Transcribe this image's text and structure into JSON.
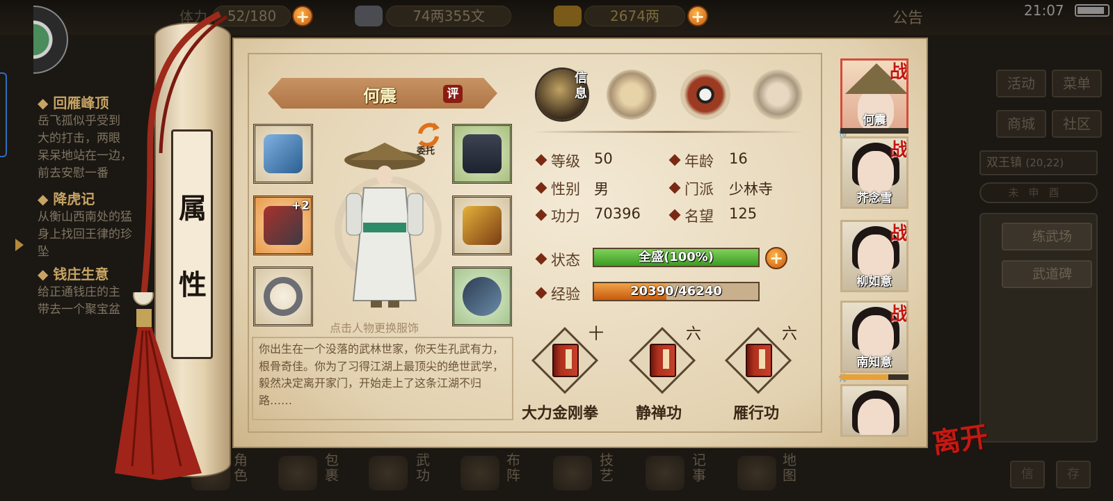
{
  "status_bar": {
    "time": "21:07"
  },
  "resources": {
    "stamina": "52/180",
    "stamina_label": "体力",
    "silver": "74两355文",
    "gold": "2674两",
    "notice": "公告"
  },
  "quests": [
    {
      "title": "回雁峰顶",
      "lines": [
        "岳飞孤似乎受到",
        "大的打击，两眼",
        "呆呆地站在一边，",
        "前去安慰一番"
      ]
    },
    {
      "title": "降虎记",
      "lines": [
        "从衡山西南处的猛",
        "身上找回王律的珍",
        "坠"
      ]
    },
    {
      "title": "钱庄生意",
      "lines": [
        "给正通钱庄的主",
        "带去一个聚宝盆"
      ]
    }
  ],
  "right_menu": {
    "activities": "活动",
    "menu": "菜单",
    "shop": "商城",
    "community": "社区",
    "town": "双王镇",
    "coords": "(20,22)",
    "time_bar": [
      "未",
      "申",
      "酉"
    ],
    "facilities": [
      "练武场",
      "武道碑"
    ],
    "bottom": [
      "信",
      "存"
    ]
  },
  "scroll_title": [
    "属",
    "性"
  ],
  "character": {
    "name": "何震",
    "rate_badge": "评",
    "entrust": "委托",
    "hint": "点击人物更换服饰",
    "bio": "你出生在一个没落的武林世家，你天生孔武有力，根骨奇佳。你为了习得江湖上最顶尖的绝世武学，毅然决定离开家门，开始走上了这条江湖不归路……",
    "equipment": [
      {
        "icon": "gauntlet-icon",
        "plus": ""
      },
      {
        "icon": "cuirass-icon",
        "plus": "+2"
      },
      {
        "icon": "ring-icon",
        "plus": ""
      },
      {
        "icon": "belt-icon",
        "plus": ""
      },
      {
        "icon": "armor-icon",
        "plus": ""
      },
      {
        "icon": "fish-amulet-icon",
        "plus": ""
      }
    ]
  },
  "tabs": {
    "info": "信息"
  },
  "stats": {
    "level_label": "等级",
    "level": "50",
    "age_label": "年龄",
    "age": "16",
    "gender_label": "性别",
    "gender": "男",
    "sect_label": "门派",
    "sect": "少林寺",
    "power_label": "功力",
    "power": "70396",
    "fame_label": "名望",
    "fame": "125",
    "status_label": "状态",
    "status": "全盛(100%)",
    "status_pct": 100,
    "exp_label": "经验",
    "exp": "20390/46240",
    "exp_pct": 44
  },
  "skills": [
    {
      "level": "十",
      "name": "大力金刚拳"
    },
    {
      "level": "六",
      "name": "静禅功"
    },
    {
      "level": "六",
      "name": "雁行功"
    }
  ],
  "party": [
    {
      "name": "何震",
      "battle": "战",
      "active": true
    },
    {
      "name": "芥念雪",
      "battle": "战",
      "active": false
    },
    {
      "name": "柳如意",
      "battle": "战",
      "active": false
    },
    {
      "name": "南知意",
      "battle": "战",
      "active": false
    },
    {
      "name": "",
      "battle": "",
      "active": false
    }
  ],
  "leave": "离开",
  "bottom_nav": [
    "角色",
    "包裹",
    "武功",
    "布阵",
    "技艺",
    "记事",
    "地图"
  ],
  "colors": {
    "status_bar": "#5bb43a",
    "exp_bar": "#e07a1a",
    "accent_red": "#c2150d"
  }
}
